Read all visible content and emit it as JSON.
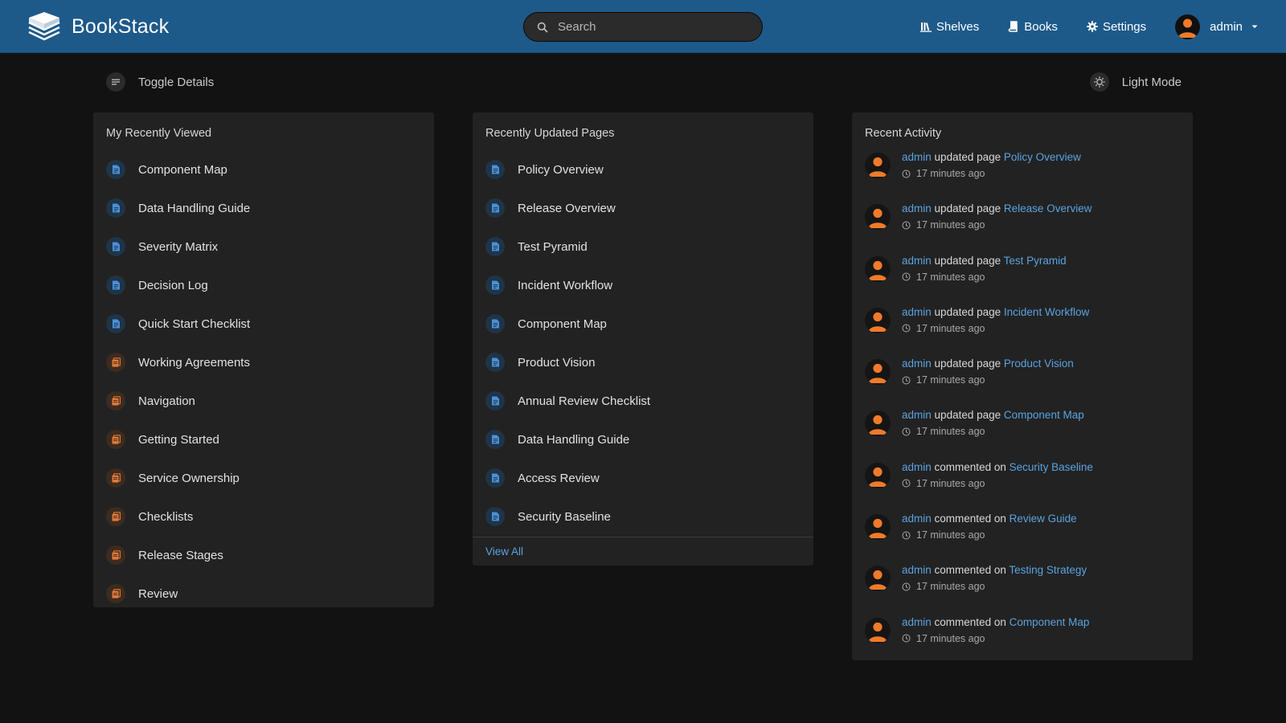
{
  "header": {
    "brand": "BookStack",
    "search_placeholder": "Search",
    "nav": [
      {
        "label": "Shelves",
        "icon": "shelves-icon"
      },
      {
        "label": "Books",
        "icon": "books-icon"
      },
      {
        "label": "Settings",
        "icon": "settings-icon"
      }
    ],
    "user": "admin"
  },
  "toolbar": {
    "toggle_details": "Toggle Details",
    "light_mode": "Light Mode"
  },
  "recently_viewed": {
    "title": "My Recently Viewed",
    "items": [
      {
        "label": "Component Map",
        "type": "page"
      },
      {
        "label": "Data Handling Guide",
        "type": "page"
      },
      {
        "label": "Severity Matrix",
        "type": "page"
      },
      {
        "label": "Decision Log",
        "type": "page"
      },
      {
        "label": "Quick Start Checklist",
        "type": "page"
      },
      {
        "label": "Working Agreements",
        "type": "chapter"
      },
      {
        "label": "Navigation",
        "type": "chapter"
      },
      {
        "label": "Getting Started",
        "type": "chapter"
      },
      {
        "label": "Service Ownership",
        "type": "chapter"
      },
      {
        "label": "Checklists",
        "type": "chapter"
      },
      {
        "label": "Release Stages",
        "type": "chapter"
      },
      {
        "label": "Review",
        "type": "chapter"
      }
    ]
  },
  "recently_updated": {
    "title": "Recently Updated Pages",
    "items": [
      {
        "label": "Policy Overview",
        "type": "page"
      },
      {
        "label": "Release Overview",
        "type": "page"
      },
      {
        "label": "Test Pyramid",
        "type": "page"
      },
      {
        "label": "Incident Workflow",
        "type": "page"
      },
      {
        "label": "Component Map",
        "type": "page"
      },
      {
        "label": "Product Vision",
        "type": "page"
      },
      {
        "label": "Annual Review Checklist",
        "type": "page"
      },
      {
        "label": "Data Handling Guide",
        "type": "page"
      },
      {
        "label": "Access Review",
        "type": "page"
      },
      {
        "label": "Security Baseline",
        "type": "page"
      }
    ],
    "view_all": "View All"
  },
  "recent_activity": {
    "title": "Recent Activity",
    "items": [
      {
        "user": "admin",
        "verb": "updated page",
        "target": "Policy Overview",
        "time": "17 minutes ago"
      },
      {
        "user": "admin",
        "verb": "updated page",
        "target": "Release Overview",
        "time": "17 minutes ago"
      },
      {
        "user": "admin",
        "verb": "updated page",
        "target": "Test Pyramid",
        "time": "17 minutes ago"
      },
      {
        "user": "admin",
        "verb": "updated page",
        "target": "Incident Workflow",
        "time": "17 minutes ago"
      },
      {
        "user": "admin",
        "verb": "updated page",
        "target": "Product Vision",
        "time": "17 minutes ago"
      },
      {
        "user": "admin",
        "verb": "updated page",
        "target": "Component Map",
        "time": "17 minutes ago"
      },
      {
        "user": "admin",
        "verb": "commented on",
        "target": "Security Baseline",
        "time": "17 minutes ago"
      },
      {
        "user": "admin",
        "verb": "commented on",
        "target": "Review Guide",
        "time": "17 minutes ago"
      },
      {
        "user": "admin",
        "verb": "commented on",
        "target": "Testing Strategy",
        "time": "17 minutes ago"
      },
      {
        "user": "admin",
        "verb": "commented on",
        "target": "Component Map",
        "time": "17 minutes ago"
      }
    ]
  },
  "colors": {
    "header_bg": "#1d5a8a",
    "page_bg": "#121212",
    "card_bg": "#222222",
    "link": "#5aa3e0",
    "page_icon": "#4a90d9",
    "chapter_icon": "#e07a3a",
    "avatar_orange": "#f07a2a"
  }
}
